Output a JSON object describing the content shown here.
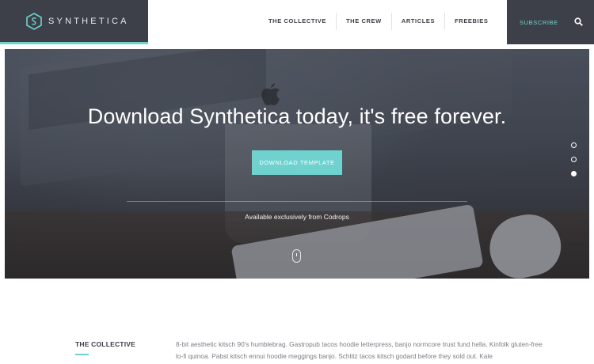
{
  "header": {
    "logo_text": "SYNTHETICA",
    "nav": [
      "THE COLLECTIVE",
      "THE CREW",
      "ARTICLES",
      "FREEBIES"
    ],
    "subscribe": "SUBSCRIBE"
  },
  "hero": {
    "title": "Download Synthetica today, it's free forever.",
    "button": "DOWNLOAD TEMPLATE",
    "subtitle": "Available exclusively from Codrops",
    "slides_total": 3,
    "active_slide": 3
  },
  "section": {
    "heading": "THE COLLECTIVE",
    "body": "8-bit aesthetic kitsch 90's humblebrag. Gastropub tacos hoodie letterpress, banjo normcore trust fund hella. Kinfolk gluten-free lo-fi quinoa. Pabst kitsch ennui hoodie meggings banjo. Schlitz tacos kitsch godard before they sold out. Kale"
  },
  "colors": {
    "accent": "#6fd2cf",
    "dark": "#3d4048"
  }
}
